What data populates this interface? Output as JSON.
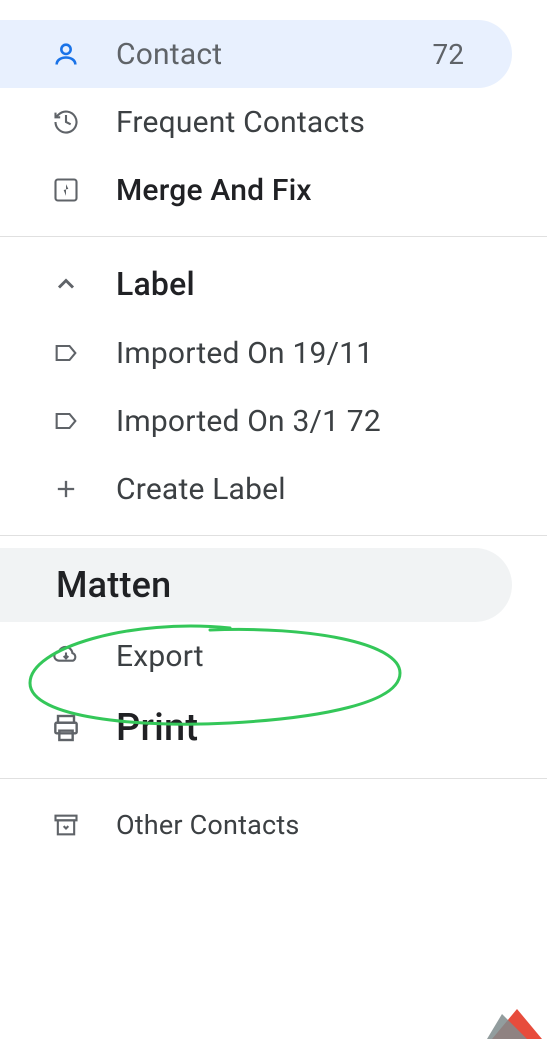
{
  "sidebar": {
    "contact": {
      "label": "Contact",
      "count": "72"
    },
    "frequent": {
      "label": "Frequent Contacts"
    },
    "merge": {
      "label": "Merge And Fix"
    },
    "labels_header": "Label",
    "labels": [
      {
        "label": "Imported On 19/11"
      },
      {
        "label": "Imported On 3/1 72"
      }
    ],
    "create_label": "Create Label",
    "matten": {
      "label": "Matten"
    },
    "export": {
      "label": "Export"
    },
    "print": {
      "label": "Print"
    },
    "other": {
      "label": "Other Contacts"
    }
  }
}
